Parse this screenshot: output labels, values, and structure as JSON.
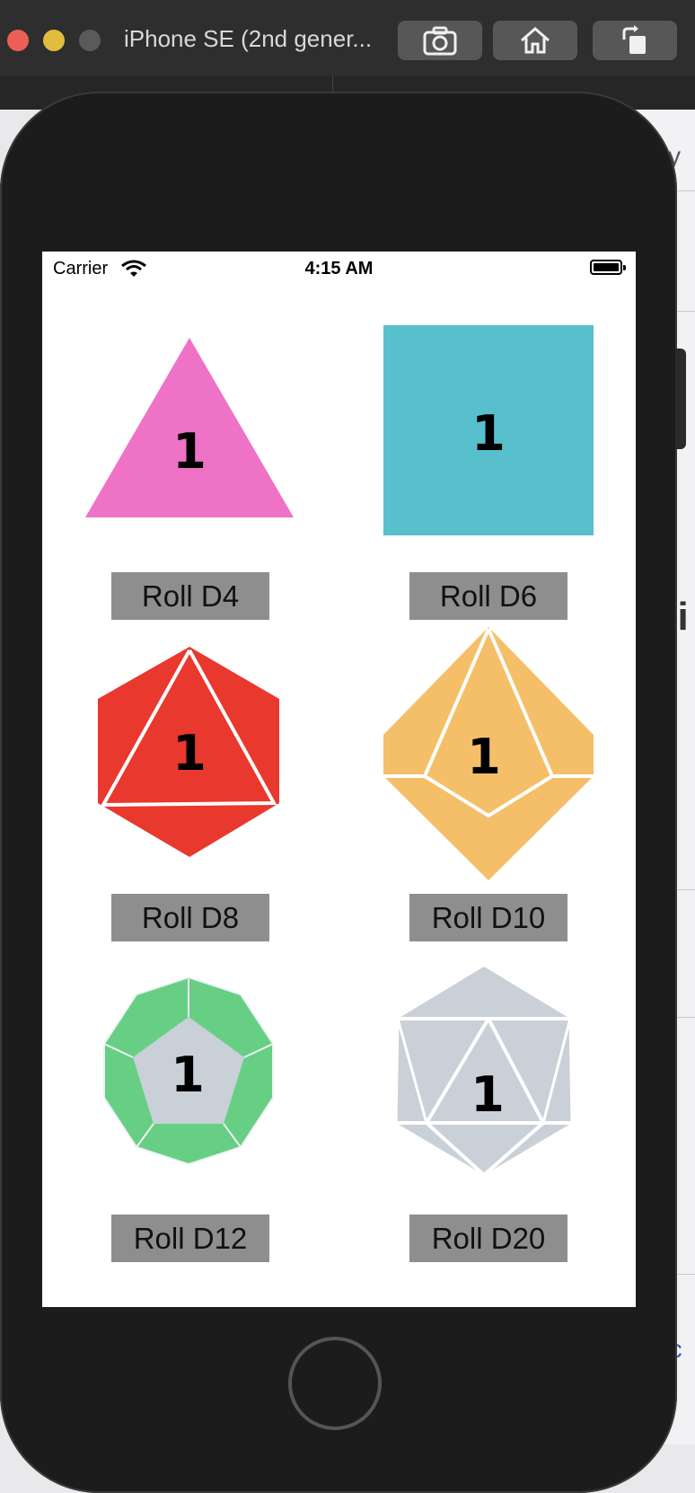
{
  "window": {
    "title": "iPhone SE (2nd gener...",
    "toolbar": [
      "screenshot-icon",
      "home-icon",
      "rotate-icon"
    ]
  },
  "status_bar": {
    "carrier": "Carrier",
    "time": "4:15 AM"
  },
  "dice": [
    {
      "id": "d4",
      "value": "1",
      "button": "Roll D4",
      "color": "#ee72c6"
    },
    {
      "id": "d6",
      "value": "1",
      "button": "Roll D6",
      "color": "#58bfcc"
    },
    {
      "id": "d8",
      "value": "1",
      "button": "Roll D8",
      "color": "#e9382e"
    },
    {
      "id": "d10",
      "value": "1",
      "button": "Roll D10",
      "color": "#f4bf68"
    },
    {
      "id": "d12",
      "value": "1",
      "button": "Roll D12",
      "color": "#67cf84",
      "face_color": "#c9d0d8"
    },
    {
      "id": "d20",
      "value": "1",
      "button": "Roll D20",
      "color": "#c9d0d8"
    }
  ],
  "colors": {
    "button_bg": "#8e8e8e",
    "screen_bg": "#ffffff",
    "phone_body": "#1c1c1c"
  }
}
